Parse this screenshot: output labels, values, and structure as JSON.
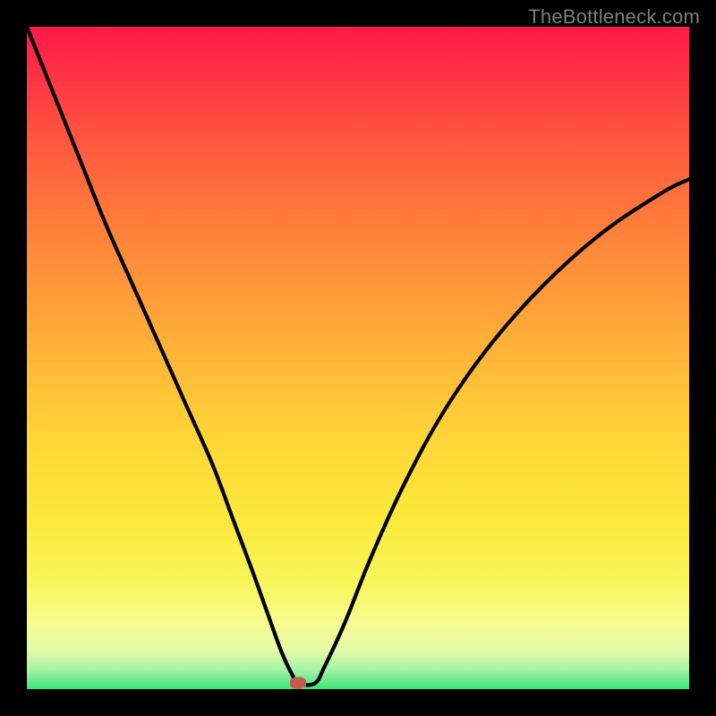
{
  "watermark": "TheBottleneck.com",
  "chart_data": {
    "type": "line",
    "title": "",
    "xlabel": "",
    "ylabel": "",
    "xlim": [
      0,
      100
    ],
    "ylim": [
      0,
      100
    ],
    "grid": false,
    "colors": {
      "curve": "#000000",
      "marker": "#c35a50",
      "gradient_top": "#fe1848",
      "gradient_mid": "#ffd537",
      "gradient_bottom": "#3ee47c"
    },
    "marker": {
      "x": 41,
      "y": 0.9
    },
    "series": [
      {
        "name": "bottleneck-curve",
        "x": [
          0,
          4,
          8,
          12,
          16,
          20,
          24,
          28,
          31,
          34,
          36.5,
          38.5,
          40,
          41,
          43.5,
          45,
          48,
          52,
          57,
          63,
          70,
          78,
          87,
          96,
          100
        ],
        "y": [
          100,
          90,
          80,
          70,
          61,
          52,
          43,
          34,
          26,
          18,
          11,
          5.5,
          2.3,
          0.9,
          0.9,
          3.5,
          10,
          20,
          31,
          42,
          52,
          61,
          69,
          75,
          77
        ]
      }
    ]
  }
}
